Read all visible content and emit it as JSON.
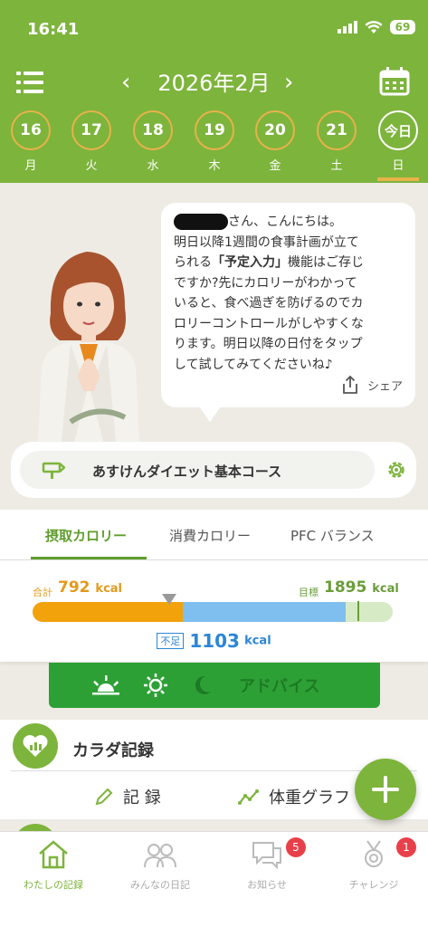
{
  "status": {
    "time": "16:41",
    "battery": "69"
  },
  "header": {
    "month": "2026年2月",
    "prev": "‹",
    "next": "›",
    "days": [
      {
        "num": "16",
        "dow": "月"
      },
      {
        "num": "17",
        "dow": "火"
      },
      {
        "num": "18",
        "dow": "水"
      },
      {
        "num": "19",
        "dow": "木"
      },
      {
        "num": "20",
        "dow": "金"
      },
      {
        "num": "21",
        "dow": "土"
      },
      {
        "num": "今日",
        "dow": "日"
      }
    ]
  },
  "advice": {
    "greeting": "さん、こんにちは。",
    "line1": "明日以降1週間の食事計画が立て",
    "line2_pre": "られる",
    "line2_bold": "「予定入力」",
    "line2_post": "機能はご存じ",
    "line3": "ですか?先にカロリーがわかって",
    "line4": "いると、食べ過ぎを防げるのでカ",
    "line5": "ロリーコントロールがしやすくな",
    "line6": "ります。明日以降の日付をタップ",
    "line7": "して試してみてくださいね♪",
    "share": "シェア"
  },
  "course": {
    "label": "あすけんダイエット基本コース"
  },
  "tabs": {
    "intake": "摂取カロリー",
    "burn": "消費カロリー",
    "pfc": "PFC バランス"
  },
  "calories": {
    "total_label": "合計",
    "total": "792",
    "goal_label": "目標",
    "goal": "1895",
    "unit": "kcal",
    "shortage_label": "不足",
    "shortage": "1103",
    "intake_fraction": 0.418,
    "goal_fraction": 0.95
  },
  "advice_bar": {
    "label": "アドバイス"
  },
  "body_record": {
    "title": "カラダ記録",
    "record": "記 録",
    "graph": "体重グラフ"
  },
  "nav": {
    "home": "わたしの記録",
    "diary": "みんなの日記",
    "news": "お知らせ",
    "news_badge": "5",
    "challenge": "チャレンジ",
    "challenge_badge": "1"
  },
  "colors": {
    "brand": "#7DB43C",
    "intake": "#F2A20A",
    "shortage": "#7FBFEF",
    "advice": "#2DA035"
  }
}
